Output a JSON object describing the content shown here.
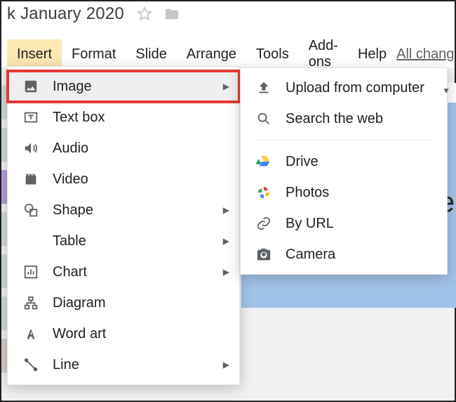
{
  "doc_title": "k January 2020",
  "menubar": {
    "items": [
      "Insert",
      "Format",
      "Slide",
      "Arrange",
      "Tools",
      "Add-ons",
      "Help"
    ],
    "active_index": 0,
    "all_changes": "All chang"
  },
  "insert_menu": {
    "items": [
      {
        "icon": "image-icon",
        "label": "Image",
        "has_submenu": true,
        "highlighted": true
      },
      {
        "icon": "textbox-icon",
        "label": "Text box",
        "has_submenu": false
      },
      {
        "icon": "audio-icon",
        "label": "Audio",
        "has_submenu": false
      },
      {
        "icon": "video-icon",
        "label": "Video",
        "has_submenu": false
      },
      {
        "icon": "shape-icon",
        "label": "Shape",
        "has_submenu": true
      },
      {
        "icon": "",
        "label": "Table",
        "has_submenu": true
      },
      {
        "icon": "chart-icon",
        "label": "Chart",
        "has_submenu": true
      },
      {
        "icon": "diagram-icon",
        "label": "Diagram",
        "has_submenu": false
      },
      {
        "icon": "wordart-icon",
        "label": "Word art",
        "has_submenu": false
      },
      {
        "icon": "line-icon",
        "label": "Line",
        "has_submenu": true
      }
    ]
  },
  "image_submenu": {
    "items": [
      {
        "icon": "upload-icon",
        "label": "Upload from computer"
      },
      {
        "icon": "search-icon",
        "label": "Search the web"
      },
      {
        "separator": true
      },
      {
        "icon": "drive-icon",
        "label": "Drive"
      },
      {
        "icon": "photos-icon",
        "label": "Photos"
      },
      {
        "icon": "link-icon",
        "label": "By URL"
      },
      {
        "icon": "camera-icon",
        "label": "Camera"
      }
    ]
  },
  "slide_fragment_letter": "e"
}
